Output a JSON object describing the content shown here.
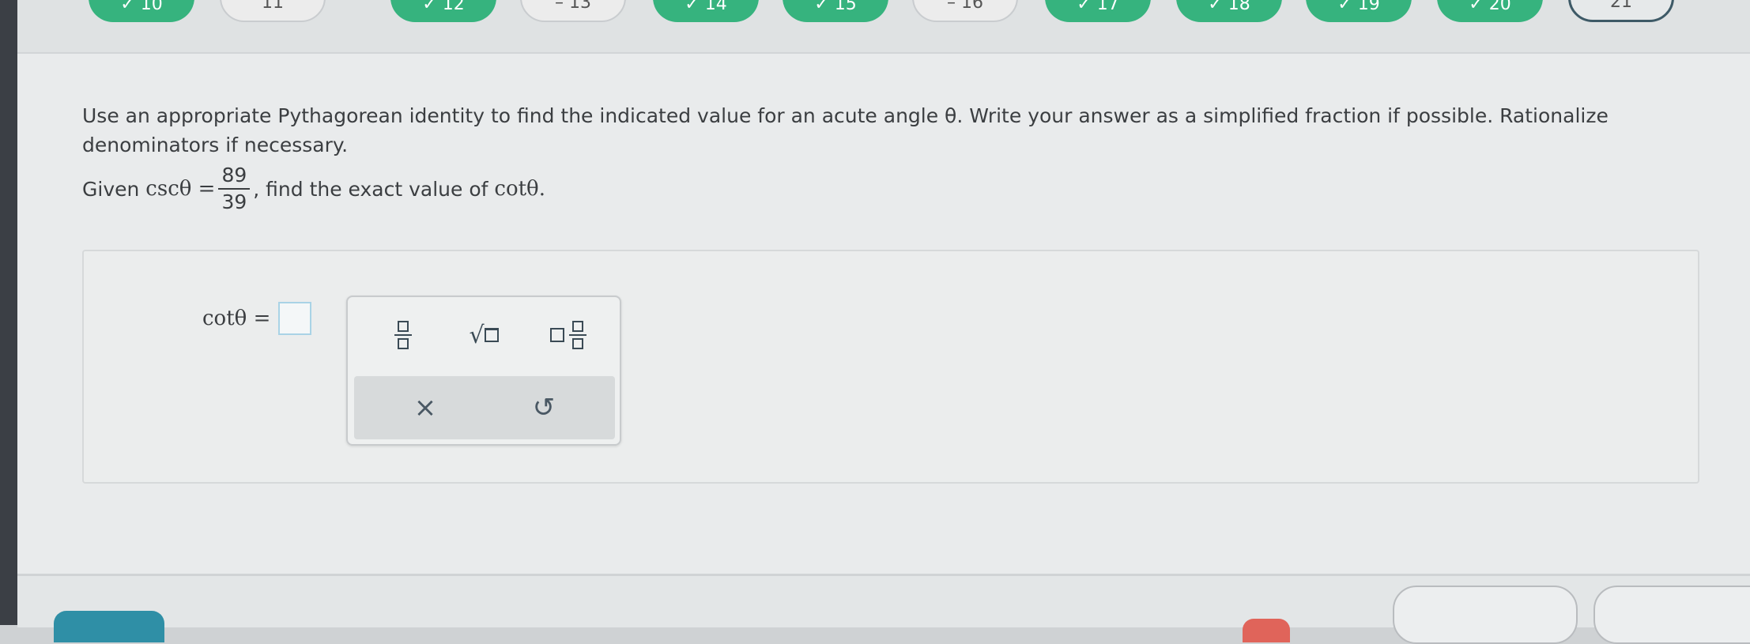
{
  "nav": {
    "questions": [
      {
        "label": "10",
        "state": "done"
      },
      {
        "label": "11",
        "state": "plain"
      },
      {
        "label": "12",
        "state": "done"
      },
      {
        "label": "13",
        "state": "plain"
      },
      {
        "label": "14",
        "state": "done"
      },
      {
        "label": "15",
        "state": "done"
      },
      {
        "label": "16",
        "state": "plain"
      },
      {
        "label": "17",
        "state": "done"
      },
      {
        "label": "18",
        "state": "done"
      },
      {
        "label": "19",
        "state": "done"
      },
      {
        "label": "20",
        "state": "done"
      },
      {
        "label": "21",
        "state": "current"
      }
    ]
  },
  "question": {
    "prompt": "Use an appropriate Pythagorean identity to find the indicated value for an acute angle θ. Write your answer as a simplified fraction if possible. Rationalize denominators if necessary.",
    "given_prefix": "Given",
    "given_func": "cscθ =",
    "given_num": "89",
    "given_den": "39",
    "given_suffix": ", find the exact value of",
    "target_func": "cotθ."
  },
  "answer": {
    "label": "cotθ =",
    "value": ""
  },
  "palette": {
    "clear_symbol": "×",
    "undo_symbol": "↺"
  },
  "colors": {
    "done_pill": "#36b37e",
    "current_outline": "#3e5a67",
    "input_border": "#a9d3e6"
  }
}
